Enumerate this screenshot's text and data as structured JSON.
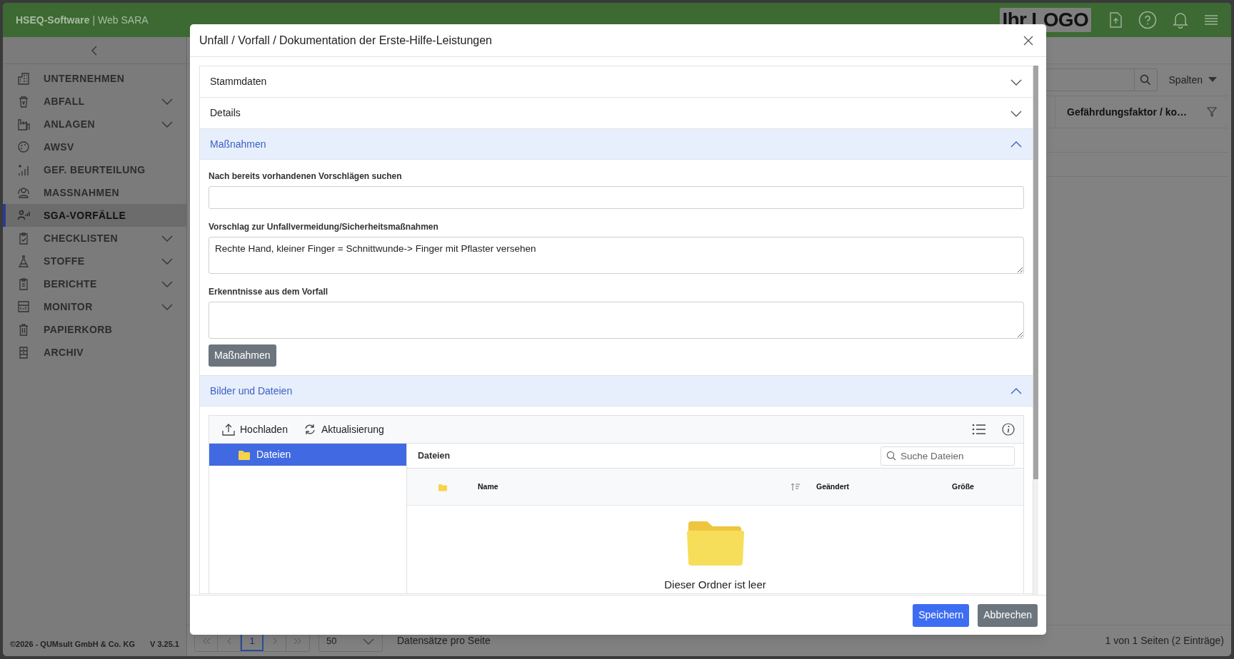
{
  "app": {
    "brand": "HSEQ-Software",
    "separator": "|",
    "product": "Web SARA",
    "logo": "Ihr LOGO"
  },
  "sidebar": {
    "items": [
      {
        "label": "UNTERNEHMEN",
        "expandable": false,
        "selected": false
      },
      {
        "label": "ABFALL",
        "expandable": true,
        "selected": false
      },
      {
        "label": "ANLAGEN",
        "expandable": true,
        "selected": false
      },
      {
        "label": "AWSV",
        "expandable": false,
        "selected": false
      },
      {
        "label": "GEF. BEURTEILUNG",
        "expandable": false,
        "selected": false
      },
      {
        "label": "MASSNAHMEN",
        "expandable": false,
        "selected": false
      },
      {
        "label": "SGA-VORFÄLLE",
        "expandable": false,
        "selected": true
      },
      {
        "label": "CHECKLISTEN",
        "expandable": true,
        "selected": false
      },
      {
        "label": "STOFFE",
        "expandable": true,
        "selected": false
      },
      {
        "label": "BERICHTE",
        "expandable": true,
        "selected": false
      },
      {
        "label": "MONITOR",
        "expandable": true,
        "selected": false
      },
      {
        "label": "PAPIERKORB",
        "expandable": false,
        "selected": false
      },
      {
        "label": "ARCHIV",
        "expandable": false,
        "selected": false
      }
    ],
    "copyright": "©2026 - QUMsult GmbH & Co. KG",
    "version": "V 3.25.1"
  },
  "list": {
    "columns_button": "Spalten",
    "column_header": "Gefährdungsfaktor / ko…",
    "pagination": {
      "pages": [
        {
          "label": "1",
          "selected": true
        }
      ],
      "page_size": "50",
      "page_size_label": "Datensätze pro Seite",
      "summary": "1 von 1 Seiten (2 Einträge)"
    }
  },
  "dialog": {
    "title": "Unfall / Vorfall / Dokumentation der Erste-Hilfe-Leistungen",
    "sections": [
      {
        "title": "Stammdaten",
        "expanded": false
      },
      {
        "title": "Details",
        "expanded": false
      },
      {
        "title": "Maßnahmen",
        "expanded": true,
        "kind": "measures",
        "fields": [
          {
            "kind": "input",
            "label": "Nach bereits vorhandenen Vorschlägen suchen"
          },
          {
            "kind": "textarea",
            "label": "Vorschlag zur Unfallvermeidung/Sicherheitsmaßnahmen",
            "value": "Rechte Hand, kleiner Finger = Schnittwunde-> Finger mit Pflaster versehen"
          },
          {
            "kind": "textarea",
            "label": "Erkenntnisse aus dem Vorfall"
          }
        ],
        "button": "Maßnahmen"
      },
      {
        "title": "Bilder und Dateien",
        "expanded": true,
        "kind": "files",
        "toolbar": [
          "Hochladen",
          "Aktualisierung"
        ],
        "tree": [
          {
            "label": "Dateien",
            "selected": true
          }
        ],
        "breadcrumb": "Dateien",
        "search_placeholder": "Suche Dateien",
        "columns": [
          "Name",
          "Geändert",
          "Größe"
        ],
        "empty_text": "Dieser Ordner ist leer"
      }
    ],
    "buttons": [
      {
        "label": "Speichern",
        "kind": "primary"
      },
      {
        "label": "Abbrechen",
        "kind": "secondary"
      }
    ]
  }
}
